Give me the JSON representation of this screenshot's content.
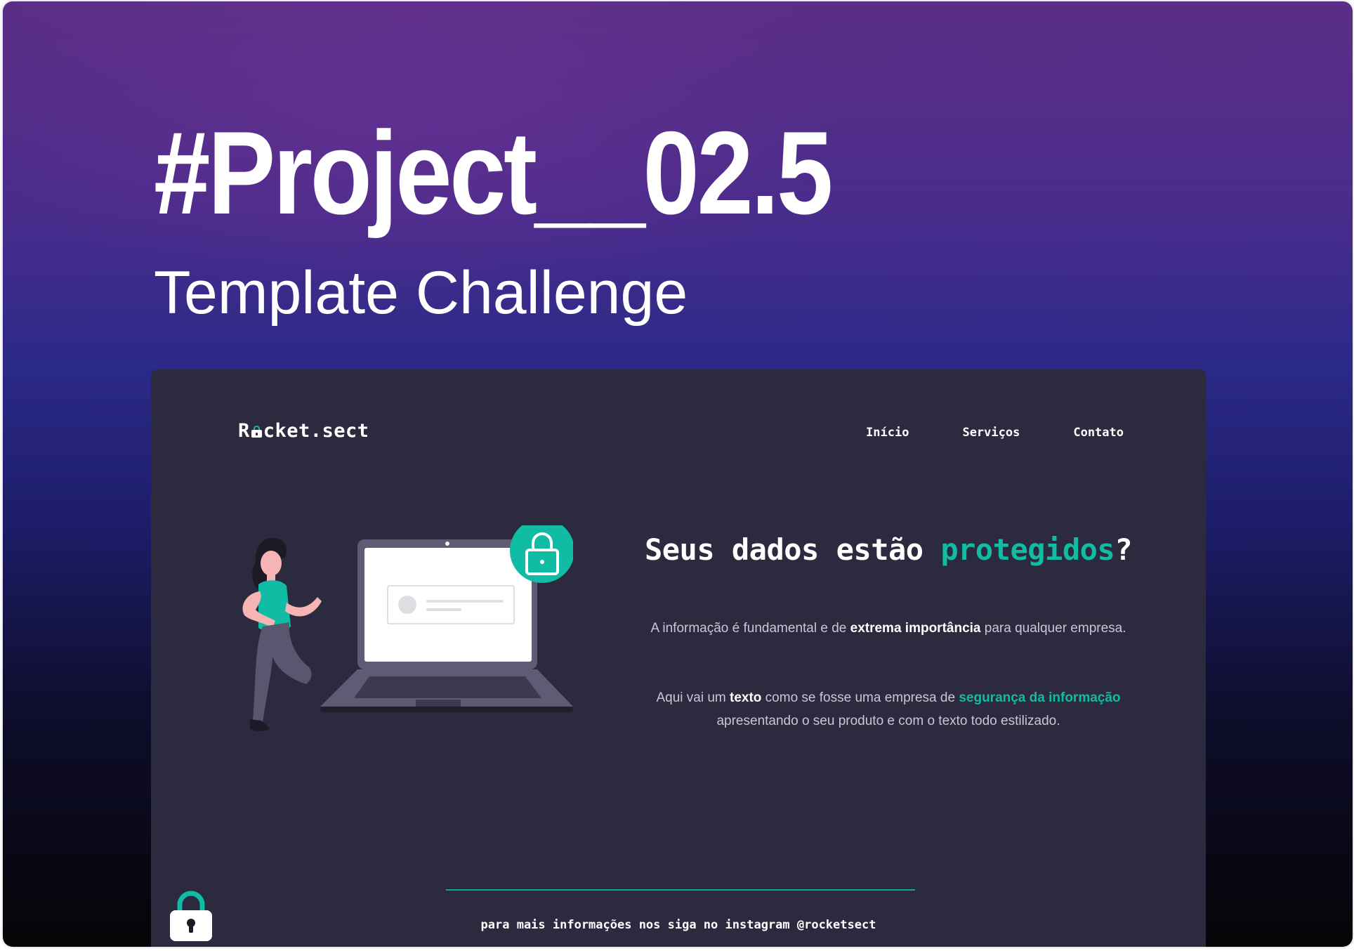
{
  "hero": {
    "title": "#Project__02.5",
    "subtitle": "Template Challenge"
  },
  "site": {
    "logo_prefix": "R",
    "logo_suffix": "cket.sect",
    "nav": [
      "Início",
      "Serviços",
      "Contato"
    ],
    "headline_pre": "Seus dados estão ",
    "headline_accent": "protegidos",
    "headline_post": "?",
    "paragraph1": {
      "t1": "A informação é fundamental e de ",
      "b1": "extrema importância",
      "t2": " para qualquer empresa."
    },
    "paragraph2": {
      "t1": "Aqui vai um ",
      "b1": "texto",
      "t2": " como se fosse uma empresa de ",
      "accent": "segurança da informação",
      "t3": " apresentando o seu produto e com o texto todo estilizado."
    },
    "footer": "para mais informações nos siga no instagram @rocketsect"
  },
  "colors": {
    "accent": "#10bca4",
    "site_background": "#2c2a3e",
    "gradient_top": "#5b2e86",
    "gradient_bottom": "#050507"
  },
  "icons": [
    "lock-icon",
    "laptop-illustration",
    "woman-illustration"
  ]
}
